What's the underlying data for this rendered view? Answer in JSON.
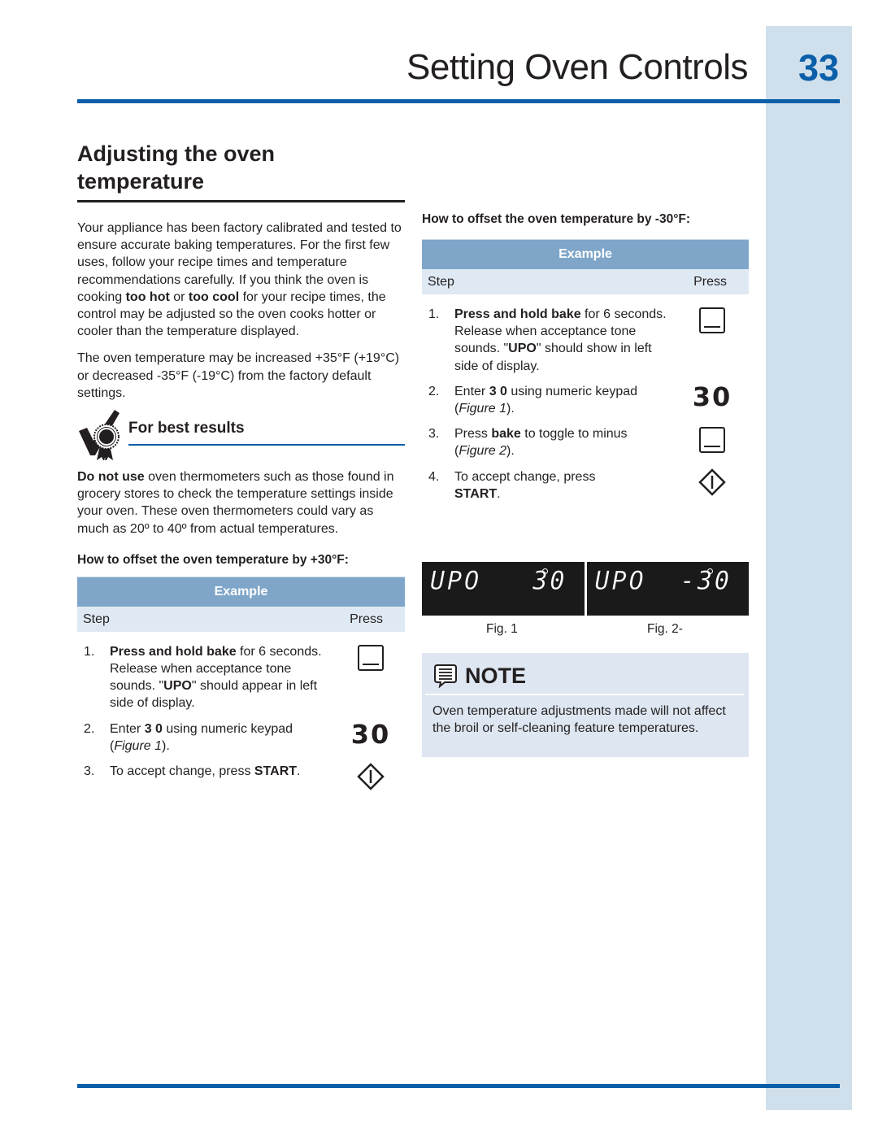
{
  "header": {
    "title": "Setting Oven Controls",
    "page_number": "33"
  },
  "colors": {
    "accent_blue": "#0b5ea8",
    "side_band": "#cfdfec",
    "example_header": "#7fa6c9",
    "example_subheader": "#dfe9f3",
    "note_background": "#dde6f1",
    "display_background": "#1b1a1a"
  },
  "section": {
    "title_line1": "Adjusting the oven",
    "title_line2": "temperature",
    "intro": {
      "part1": "Your appliance has been factory calibrated and tested to ensure accurate baking temperatures. For the first few uses, follow your recipe times and temperature recommendations carefully. If you think the oven is cooking ",
      "bold1": "too hot",
      "part2": " or ",
      "bold2": "too cool",
      "part3": " for your recipe times, the control may be adjusted so the oven cooks hotter or cooler than the temperature displayed."
    },
    "range_text": "The oven temperature may be increased +35°F (+19°C) or decreased -35°F (-19°C) from the factory default settings."
  },
  "best_results": {
    "icon": "checkmark-ribbon-icon",
    "title": "For best results",
    "bold": "Do not use",
    "text": " oven thermometers such as those found in grocery stores to check the temperature settings inside your oven. These oven thermometers could vary as much as 20º to 40º from actual temperatures."
  },
  "increase_example": {
    "heading": "How to offset the oven temperature by +30°F:",
    "table_title": "Example",
    "col_step": "Step",
    "col_press": "Press",
    "steps": [
      {
        "num": "1.",
        "bold": "Press and hold bake",
        "text": " for 6 seconds. Release when acceptance tone sounds. \"",
        "bold2": "UPO",
        "text2": "\" should appear in left side of display.",
        "press": "bake-icon"
      },
      {
        "num": "2.",
        "pre": "Enter ",
        "bold": "3 0",
        "text": " using numeric keypad (",
        "italic": "Figure 1",
        "post": ").",
        "press_value": "30"
      },
      {
        "num": "3.",
        "pre": "To accept change, press ",
        "bold": "START",
        "post": ".",
        "press": "start-icon"
      }
    ]
  },
  "decrease_example": {
    "heading": "How to offset the oven temperature by -30°F:",
    "table_title": "Example",
    "col_step": "Step",
    "col_press": "Press",
    "steps": [
      {
        "num": "1.",
        "bold": "Press and hold bake",
        "text": " for 6 seconds. Release when acceptance tone sounds. \"",
        "bold2": "UPO",
        "text2": "\" should show in left side of display.",
        "press": "bake-icon"
      },
      {
        "num": "2.",
        "pre": "Enter ",
        "bold": "3 0",
        "text": " using numeric keypad (",
        "italic": "Figure 1",
        "post": ").",
        "press_value": "30"
      },
      {
        "num": "3.",
        "pre": "Press ",
        "bold": "bake",
        "text": " to toggle to minus (",
        "italic": "Figure 2",
        "post": ").",
        "press": "bake-icon"
      },
      {
        "num": "4.",
        "pre": "To accept change, press ",
        "bold": "START",
        "post": ".",
        "press": "start-icon"
      }
    ]
  },
  "figures": [
    {
      "display": "UPO   30",
      "caption": "Fig. 1"
    },
    {
      "display": "UPO  -30",
      "caption": "Fig. 2-"
    }
  ],
  "note": {
    "icon": "speech-bubble-note-icon",
    "label": "NOTE",
    "text": "Oven temperature adjustments made will not affect the broil or self-cleaning feature temperatures."
  }
}
